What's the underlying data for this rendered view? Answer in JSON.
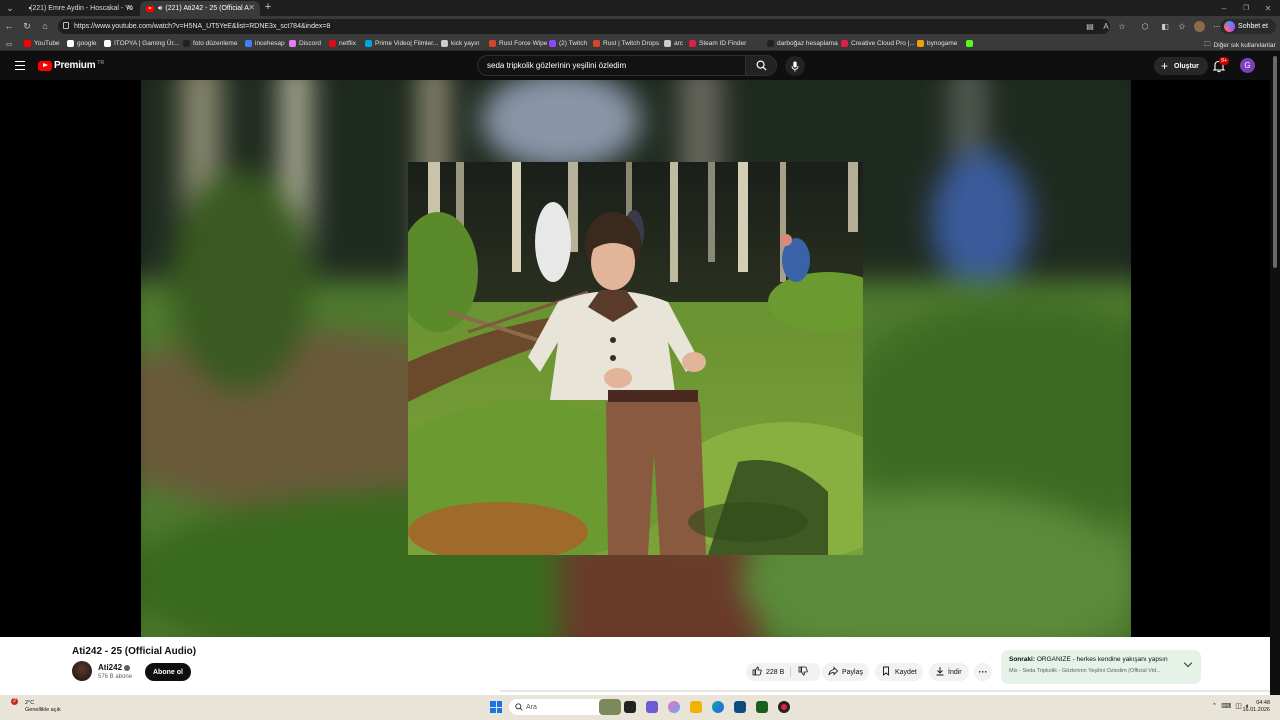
{
  "browser": {
    "tabs": [
      {
        "label": "(221) Emre Aydin - Hoscakal - Yo"
      },
      {
        "label": "(221) Ati242 - 25 (Official A"
      }
    ],
    "url": "https://www.youtube.com/watch?v=H5NA_UT5YeE&list=RDNE3x_sct784&index=8",
    "chat_button": "Sohbet et"
  },
  "bookmarks": [
    {
      "label": "YouTube",
      "color": "#ff0000"
    },
    {
      "label": "google",
      "color": "#ffffff"
    },
    {
      "label": "ITOPYA | Gaming Ür...",
      "color": "#ffffff"
    },
    {
      "label": "foto düzenleme",
      "color": "#222222"
    },
    {
      "label": "incehesap",
      "color": "#3b82f6"
    },
    {
      "label": "Discord",
      "color": "#e879f9"
    },
    {
      "label": "netflix",
      "color": "#e50914"
    },
    {
      "label": "Prime Video| Filmler...",
      "color": "#00a8e1"
    },
    {
      "label": "kick yayın",
      "color": "#cccccc"
    },
    {
      "label": "Rust Force Wipe",
      "color": "#d9442c"
    },
    {
      "label": "(2) Twitch",
      "color": "#9146ff"
    },
    {
      "label": "Rust | Twitch Drops",
      "color": "#d9442c"
    },
    {
      "label": "arc",
      "color": "#cccccc"
    },
    {
      "label": "Steam ID Finder",
      "color": "#e11d48"
    },
    {
      "label": "darboğaz hesaplama",
      "color": "#222222"
    },
    {
      "label": "Creative Cloud Pro |...",
      "color": "#e11d48"
    },
    {
      "label": "bynogame",
      "color": "#f59e0b"
    },
    {
      "label": "",
      "color": "#53fc18"
    }
  ],
  "other_bookmarks": "Diğer sık kullanılanlar",
  "youtube": {
    "logo_text": "Premium",
    "logo_region": "TR",
    "search_query": "seda tripkolik gözlerinin yeşilini özledim",
    "create_label": "Oluştur",
    "notif_count": "9+",
    "avatar_letter": "G"
  },
  "video": {
    "title": "Ati242 - 25 (Official Audio)",
    "channel": "Ati242",
    "subscribers": "576 B abone",
    "subscribe_label": "Abone ol",
    "likes": "228 B",
    "share_label": "Paylaş",
    "save_label": "Kaydet",
    "download_label": "İndir",
    "more_label": "···"
  },
  "next_up": {
    "prefix": "Sonraki:",
    "title": "ORGANIZE - herkes kendine yakışanı yapsın",
    "playlist": "Mix - Seda Tripkolik - Gözlerinin Yeşilini Özledim (Official Vid..."
  },
  "taskbar": {
    "temperature": "2°C",
    "weather": "Genellikle açık",
    "weather_badge": "2",
    "search_placeholder": "Ara",
    "time": "04:48",
    "date": "16.01.2026"
  }
}
